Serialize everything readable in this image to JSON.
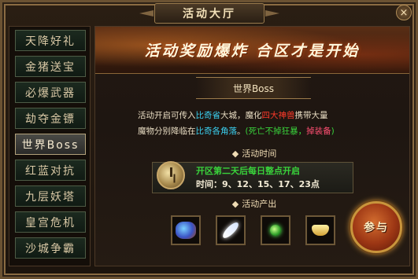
{
  "window": {
    "title": "活动大厅",
    "close_icon": "×"
  },
  "sidebar": {
    "items": [
      {
        "label": "天降好礼",
        "active": false
      },
      {
        "label": "金猪送宝",
        "active": false
      },
      {
        "label": "必爆武器",
        "active": false
      },
      {
        "label": "劫夺金镖",
        "active": false
      },
      {
        "label": "世界Boss",
        "active": true
      },
      {
        "label": "红蓝对抗",
        "active": false
      },
      {
        "label": "九层妖塔",
        "active": false
      },
      {
        "label": "皇宫危机",
        "active": false
      },
      {
        "label": "沙城争霸",
        "active": false
      }
    ]
  },
  "banner": {
    "text": "活动奖励爆炸 合区才是开始"
  },
  "boss": {
    "title": "世界Boss",
    "desc": {
      "p1": "活动开启可传入",
      "city": "比奇省",
      "p2": "大城，魔化",
      "beast": "四大神兽",
      "p3": "携带大量",
      "p4": "魔物分别降临在",
      "corners": "比奇各角落",
      "p5": "。",
      "note": "(死亡不掉狂暴，",
      "drop": "掉装备",
      "close": ")"
    }
  },
  "schedule": {
    "title": "活动时间",
    "line1": "开区第二天后每日整点开启",
    "line2": "时间：9、12、15、17、23点"
  },
  "rewards": {
    "title": "活动产出",
    "items": [
      "gem-icon",
      "feather-icon",
      "orb-icon",
      "gold-ingot-icon"
    ]
  },
  "join_button": {
    "label": "参与"
  },
  "colors": {
    "cyan": "#3bd0f0",
    "red": "#ff3a2a",
    "green": "#39d23b",
    "pink": "#ff4f72"
  }
}
